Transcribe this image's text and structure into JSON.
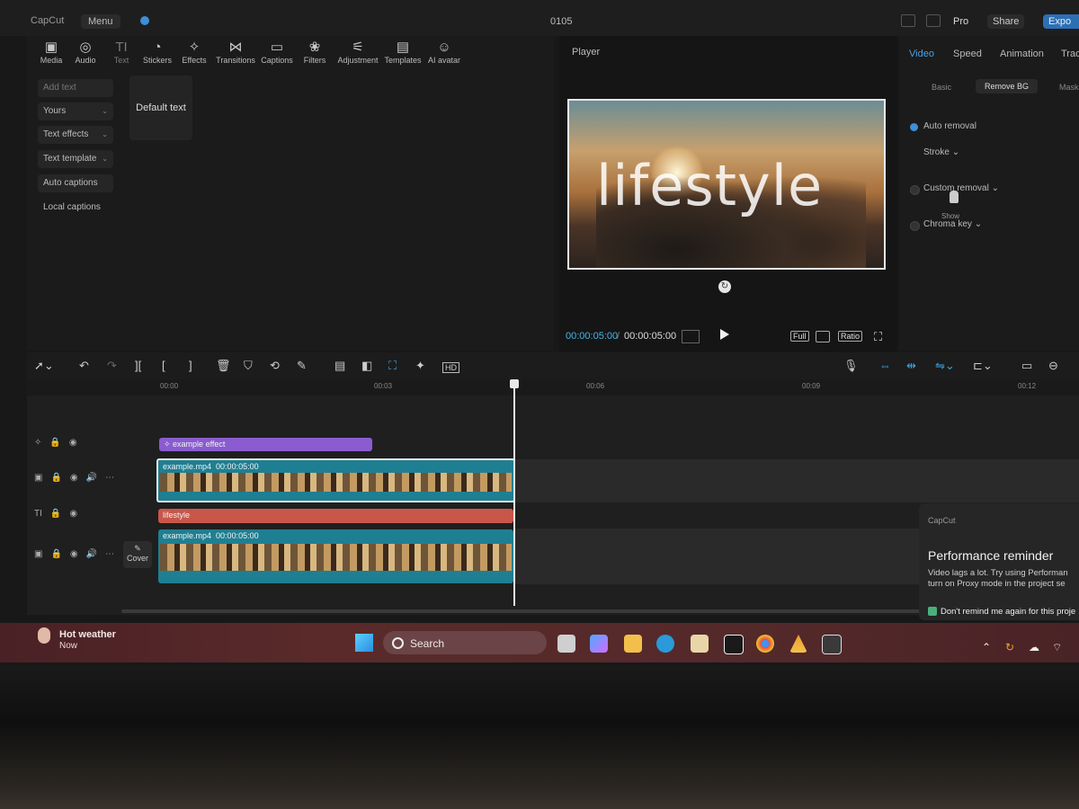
{
  "titlebar": {
    "app_name": "CapCut",
    "menu_label": "Menu",
    "project_title": "0105",
    "pro_label": "Pro",
    "share_label": "Share",
    "export_label": "Expo"
  },
  "toolbar": {
    "tabs": [
      {
        "label": "Media",
        "icon": "media-icon"
      },
      {
        "label": "Audio",
        "icon": "audio-icon"
      },
      {
        "label": "Text",
        "icon": "text-icon"
      },
      {
        "label": "Stickers",
        "icon": "sticker-icon"
      },
      {
        "label": "Effects",
        "icon": "effects-icon"
      },
      {
        "label": "Transitions",
        "icon": "transitions-icon"
      },
      {
        "label": "Captions",
        "icon": "captions-icon"
      },
      {
        "label": "Filters",
        "icon": "filters-icon"
      },
      {
        "label": "Adjustment",
        "icon": "adjustment-icon"
      },
      {
        "label": "Templates",
        "icon": "templates-icon"
      },
      {
        "label": "AI avatar",
        "icon": "avatar-icon"
      }
    ],
    "active_tab": "Text"
  },
  "text_sidebar": {
    "items": [
      "Add text",
      "Yours",
      "Text effects",
      "Text template",
      "Auto captions",
      "Local captions"
    ],
    "default_card": "Default text"
  },
  "player": {
    "title": "Player",
    "overlay_text": "lifestyle",
    "current_time": "00:00:05:00",
    "total_time": "00:00:05:00",
    "full_label": "Full",
    "ratio_label": "Ratio"
  },
  "right_panel": {
    "tabs": [
      "Video",
      "Speed",
      "Animation",
      "Track"
    ],
    "active_tab": "Video",
    "subtabs": [
      "Basic",
      "Remove BG",
      "Mask"
    ],
    "active_subtab": "Remove BG",
    "auto_removal": {
      "label": "Auto removal",
      "checked": true
    },
    "stroke_label": "Stroke",
    "custom_removal": {
      "label": "Custom removal",
      "checked": false
    },
    "tooltip": "Show",
    "chroma_key": {
      "label": "Chroma key",
      "checked": false
    }
  },
  "timeline": {
    "ruler": [
      "00:00",
      "00:03",
      "00:06",
      "00:09",
      "00:12"
    ],
    "effect_clip": "example effect",
    "main_video": {
      "name": "example.mp4",
      "duration": "00:00:05:00"
    },
    "text_clip": "lifestyle",
    "overlay_video": {
      "name": "example.mp4",
      "duration": "00:00:05:00"
    },
    "cover_label": "Cover"
  },
  "notification": {
    "brand": "CapCut",
    "title": "Performance reminder",
    "body_line1": "Video lags a lot. Try using Performan",
    "body_line2": "turn on Proxy mode in the project se",
    "option": "Don't remind me again for this proje"
  },
  "taskbar": {
    "weather_title": "Hot weather",
    "weather_sub": "Now",
    "search_placeholder": "Search"
  },
  "colors": {
    "accent_blue": "#3da3e0",
    "effect_clip": "#8a5ccf",
    "text_clip": "#c8574a",
    "video_clip": "#1f7f92"
  }
}
